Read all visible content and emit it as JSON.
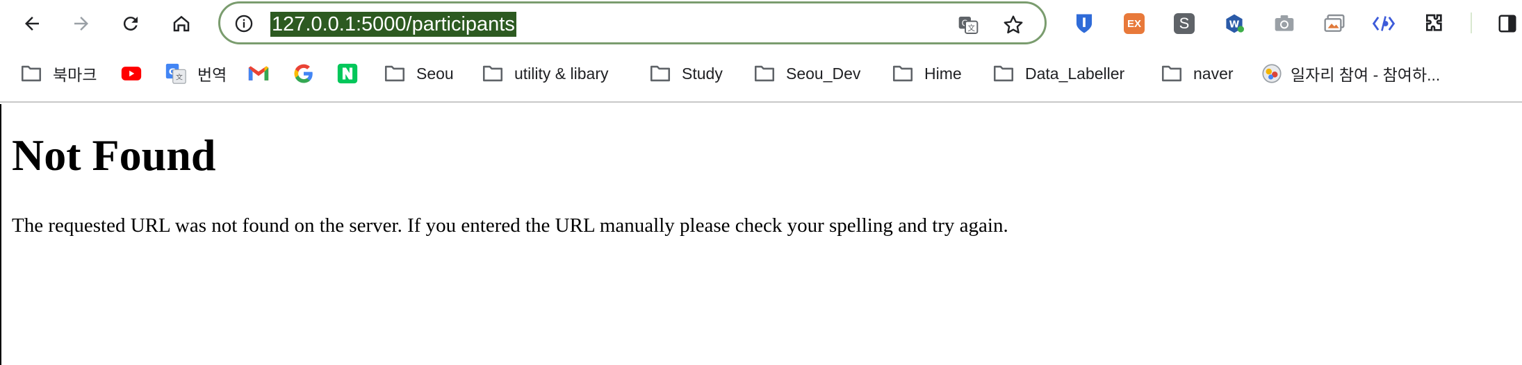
{
  "browser": {
    "url": "127.0.0.1:5000/participants",
    "accent_color": "#2d5a21",
    "omnibox_border_color": "#7a9c6e"
  },
  "toolbar_icons": [
    "back-icon",
    "forward-icon",
    "reload-icon",
    "home-icon",
    "info-icon",
    "translate-icon",
    "bookmark-star-icon"
  ],
  "extensions": [
    {
      "name": "bitwarden-extension-icon",
      "color": "#2f6bd8"
    },
    {
      "name": "ex-extension-icon",
      "label": "EX",
      "color": "#e8793a"
    },
    {
      "name": "s-extension-icon",
      "label": "S",
      "color": "#5f6368"
    },
    {
      "name": "w-extension-icon",
      "label": "W",
      "color": "#2a5aa8"
    },
    {
      "name": "camera-extension-icon",
      "color": "#9aa0a6"
    },
    {
      "name": "screenshot-extension-icon",
      "color": "#8a8f95"
    },
    {
      "name": "code-extension-icon",
      "color": "#3d5bd9"
    },
    {
      "name": "puzzle-extensions-icon",
      "color": "#202124"
    },
    {
      "name": "sidepanel-icon",
      "color": "#202124"
    }
  ],
  "bookmarks": [
    {
      "label": "북마크",
      "icon": "folder-icon"
    },
    {
      "label": "",
      "icon": "youtube-icon",
      "color": "#ff0000"
    },
    {
      "label": "번역",
      "icon": "google-translate-icon"
    },
    {
      "label": "",
      "icon": "gmail-icon"
    },
    {
      "label": "",
      "icon": "google-icon"
    },
    {
      "label": "",
      "icon": "naver-icon",
      "color": "#03c75a"
    },
    {
      "label": "Seou",
      "icon": "folder-icon"
    },
    {
      "label": "utility & libary",
      "icon": "folder-icon"
    },
    {
      "label": "Study",
      "icon": "folder-icon"
    },
    {
      "label": "Seou_Dev",
      "icon": "folder-icon"
    },
    {
      "label": "Hime",
      "icon": "folder-icon"
    },
    {
      "label": "Data_Labeller",
      "icon": "folder-icon"
    },
    {
      "label": "naver",
      "icon": "folder-icon"
    },
    {
      "label": "일자리 참여 - 참여하...",
      "icon": "globe-icon"
    }
  ],
  "page": {
    "title": "Not Found",
    "message": "The requested URL was not found on the server. If you entered the URL manually please check your spelling and try again."
  }
}
